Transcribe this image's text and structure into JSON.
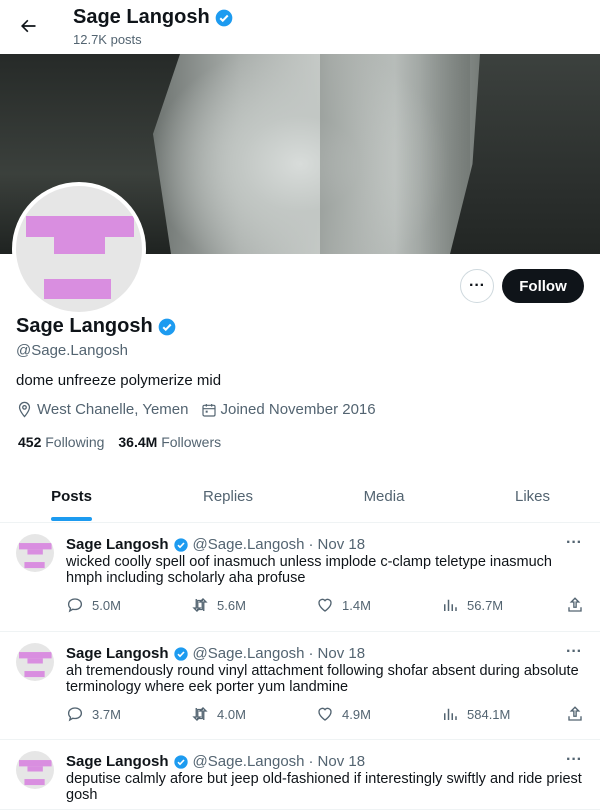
{
  "header": {
    "name": "Sage Langosh",
    "posts_count": "12.7K posts"
  },
  "profile": {
    "name": "Sage Langosh",
    "handle": "@Sage.Langosh",
    "bio": "dome unfreeze polymerize mid",
    "location": "West Chanelle, Yemen",
    "joined": "Joined November 2016",
    "following_count": "452",
    "following_label": "Following",
    "followers_count": "36.4M",
    "followers_label": "Followers",
    "follow_label": "Follow",
    "more_label": "···"
  },
  "tabs": [
    {
      "label": "Posts"
    },
    {
      "label": "Replies"
    },
    {
      "label": "Media"
    },
    {
      "label": "Likes"
    }
  ],
  "colors": {
    "accent": "#1d9bf0",
    "avatar_mark": "#d98ee0",
    "follow_bg": "#0f1419"
  },
  "posts": [
    {
      "name": "Sage Langosh",
      "handle": "@Sage.Langosh",
      "dot": "·",
      "date": "Nov 18",
      "text": "wicked coolly spell oof inasmuch unless implode c-clamp teletype inasmuch hmph including scholarly aha profuse",
      "replies": "5.0M",
      "reposts": "5.6M",
      "likes": "1.4M",
      "views": "56.7M"
    },
    {
      "name": "Sage Langosh",
      "handle": "@Sage.Langosh",
      "dot": "·",
      "date": "Nov 18",
      "text": "ah tremendously round vinyl attachment following shofar absent during absolute terminology where eek porter yum landmine",
      "replies": "3.7M",
      "reposts": "4.0M",
      "likes": "4.9M",
      "views": "584.1M"
    },
    {
      "name": "Sage Langosh",
      "handle": "@Sage.Langosh",
      "dot": "·",
      "date": "Nov 18",
      "text": "deputise calmly afore but jeep old-fashioned if interestingly swiftly and ride priest gosh",
      "replies": "",
      "reposts": "",
      "likes": "",
      "views": ""
    }
  ]
}
